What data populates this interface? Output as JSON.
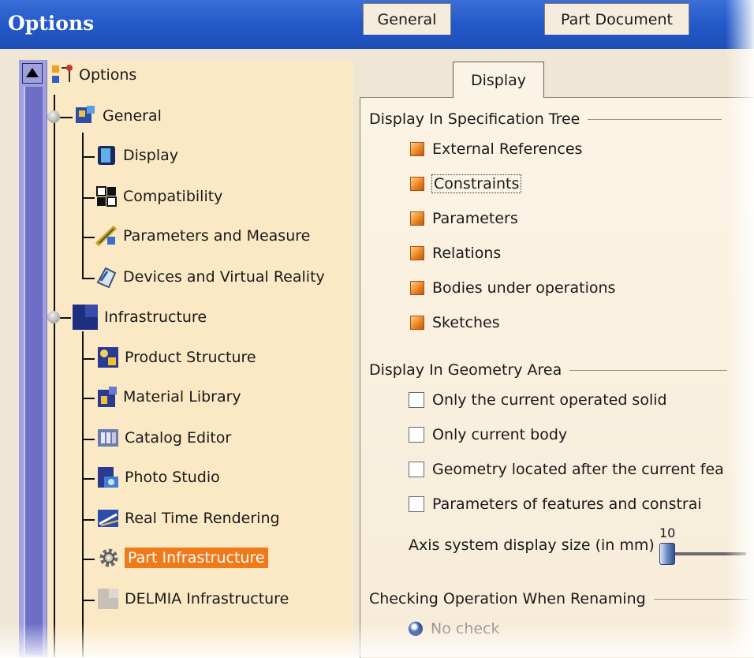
{
  "window": {
    "title": "Options"
  },
  "tree": {
    "root": {
      "label": "Options",
      "icon": "options-tree-icon"
    },
    "items": [
      {
        "label": "General",
        "icon": "general-icon"
      },
      {
        "label": "Display",
        "icon": "display-icon"
      },
      {
        "label": "Compatibility",
        "icon": "compatibility-icon"
      },
      {
        "label": "Parameters and Measure",
        "icon": "parameters-measure-icon"
      },
      {
        "label": "Devices and Virtual Reality",
        "icon": "devices-vr-icon"
      },
      {
        "label": "Infrastructure",
        "icon": "infrastructure-icon"
      },
      {
        "label": "Product Structure",
        "icon": "product-structure-icon"
      },
      {
        "label": "Material Library",
        "icon": "material-library-icon"
      },
      {
        "label": "Catalog Editor",
        "icon": "catalog-editor-icon"
      },
      {
        "label": "Photo Studio",
        "icon": "photo-studio-icon"
      },
      {
        "label": "Real Time Rendering",
        "icon": "real-time-rendering-icon"
      },
      {
        "label": "Part Infrastructure",
        "icon": "gear-icon"
      },
      {
        "label": "DELMIA Infrastructure",
        "icon": "delmia-icon"
      }
    ]
  },
  "tabs": [
    "General",
    "Display",
    "Part Document"
  ],
  "active_tab": "Display",
  "spec_tree": {
    "title": "Display In Specification Tree",
    "options": [
      {
        "label": "External References",
        "checked": true
      },
      {
        "label": "Constraints",
        "checked": true
      },
      {
        "label": "Parameters",
        "checked": true
      },
      {
        "label": "Relations",
        "checked": true
      },
      {
        "label": "Bodies under operations",
        "checked": true
      },
      {
        "label": "Sketches",
        "checked": true
      }
    ]
  },
  "geometry_area": {
    "title": "Display In Geometry Area",
    "options": [
      {
        "label": "Only the current operated solid",
        "checked": false
      },
      {
        "label": "Only current body",
        "checked": false
      },
      {
        "label": "Geometry located after the current fea",
        "checked": false
      },
      {
        "label": "Parameters of features and constrai",
        "checked": false
      }
    ],
    "axis_label": "Axis system display size (in mm)",
    "axis_value": "10"
  },
  "renaming": {
    "title": "Checking Operation When Renaming",
    "radio_label": "No check"
  },
  "colors": {
    "title_bar": "#2458c8",
    "tree_bg": "#fbe8c4",
    "selection": "#f07a1a",
    "checked": "#e8801e"
  }
}
